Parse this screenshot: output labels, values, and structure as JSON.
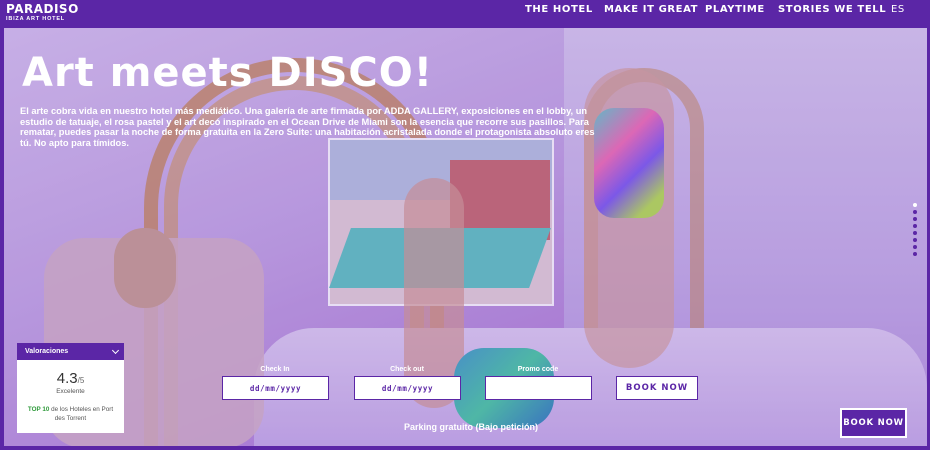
{
  "brand": {
    "name": "PARADISO",
    "tagline": "IBIZA ART HOTEL"
  },
  "nav": {
    "items": [
      "THE HOTEL",
      "MAKE IT GREAT",
      "PLAYTIME",
      "STORIES WE TELL"
    ],
    "language": "ES"
  },
  "hero": {
    "title": "Art meets DISCO!",
    "description": "El arte cobra vida en nuestro hotel más mediático. Una galería de arte firmada por ADDA GALLERY, exposiciones en el lobby, un estudio de tatuaje, el rosa pastel y el art decó inspirado en el Ocean Drive de Miami son la esencia que recorre sus pasillos. Para rematar, puedes pasar la noche de forma gratuita en la Zero Suite: una habitación acristalada donde el protagonista absoluto eres tú. No apto para tímidos.",
    "slide_count": 8,
    "active_slide": 1
  },
  "rating": {
    "header": "Valoraciones",
    "score": "4.3",
    "scale": "/5",
    "label": "Excelente",
    "top_badge": "TOP 10",
    "top_text": "de los Hoteles en Port des Torrent"
  },
  "booking": {
    "checkin_label": "Check In",
    "checkin_placeholder": "dd/mm/yyyy",
    "checkout_label": "Check out",
    "checkout_placeholder": "dd/mm/yyyy",
    "promo_label": "Promo code",
    "promo_value": "",
    "book_label": "BOOK NOW",
    "parking_note": "Parking gratuito (Bajo petición)"
  },
  "floating_book": {
    "label": "BOOK NOW"
  },
  "colors": {
    "brand_purple": "#5b26a6",
    "white": "#ffffff",
    "rating_green": "#2e9a3a"
  }
}
